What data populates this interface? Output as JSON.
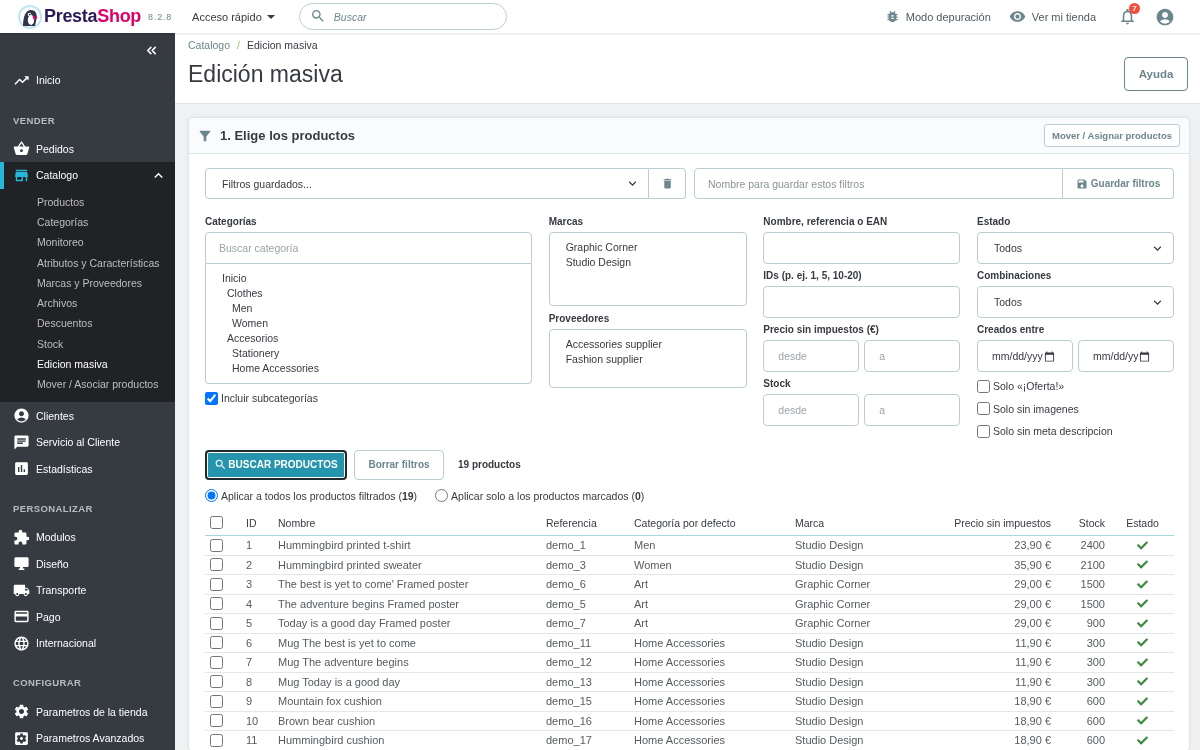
{
  "topbar": {
    "logo": {
      "parts": [
        "Presta",
        "Shop"
      ],
      "version": "8.2.8"
    },
    "quick_access": "Acceso rápido",
    "search": {
      "placeholder": "Buscar"
    },
    "debug_mode": "Modo depuración",
    "view_store": "Ver mi tienda",
    "notifications": {
      "count": "7"
    }
  },
  "sidebar": {
    "sections": [
      {
        "items": [
          {
            "label": "Inicio",
            "selected": false
          }
        ]
      },
      {
        "heading": "VENDER",
        "items": [
          {
            "label": "Pedidos",
            "selected": false
          },
          {
            "label": "Catalogo",
            "selected": true,
            "expanded": true,
            "children": [
              {
                "label": "Productos",
                "selected": false
              },
              {
                "label": "Categorías",
                "selected": false
              },
              {
                "label": "Monitoreo",
                "selected": false
              },
              {
                "label": "Atributos y Características",
                "selected": false
              },
              {
                "label": "Marcas y Proveedores",
                "selected": false
              },
              {
                "label": "Archivos",
                "selected": false
              },
              {
                "label": "Descuentos",
                "selected": false
              },
              {
                "label": "Stock",
                "selected": false
              },
              {
                "label": "Edicion masiva",
                "selected": true
              },
              {
                "label": "Mover / Asociar productos",
                "selected": false
              }
            ]
          },
          {
            "label": "Clientes",
            "selected": false
          },
          {
            "label": "Servicio al Cliente",
            "selected": false
          },
          {
            "label": "Estadísticas",
            "selected": false
          }
        ]
      },
      {
        "heading": "PERSONALIZAR",
        "items": [
          {
            "label": "Modulos",
            "selected": false
          },
          {
            "label": "Diseño",
            "selected": false
          },
          {
            "label": "Transporte",
            "selected": false
          },
          {
            "label": "Pago",
            "selected": false
          },
          {
            "label": "Internacional",
            "selected": false
          }
        ]
      },
      {
        "heading": "CONFIGURAR",
        "items": [
          {
            "label": "Parametros de la tienda",
            "selected": false
          },
          {
            "label": "Parametros Avanzados",
            "selected": false
          }
        ]
      }
    ]
  },
  "header": {
    "breadcrumb": {
      "items": [
        "Catalogo",
        "Edicion masiva"
      ],
      "separator": "/"
    },
    "title": "Edición masiva",
    "help_button": "Ayuda"
  },
  "panel": {
    "title": "1. Elige los productos",
    "action_button": "Mover / Asignar productos",
    "saved_filters": {
      "select": "Filtros guardados...",
      "name_placeholder": "Nombre para guardar estos filtros",
      "save_button": "Guardar filtros"
    },
    "categories": {
      "label": "Categorías",
      "search_placeholder": "Buscar categoría",
      "tree": [
        {
          "label": "Inicio",
          "selected": false,
          "children": [
            {
              "label": "Clothes",
              "selected": false,
              "children": [
                {
                  "label": "Men",
                  "selected": false
                },
                {
                  "label": "Women",
                  "selected": false
                }
              ]
            },
            {
              "label": "Accesorios",
              "selected": false,
              "children": [
                {
                  "label": "Stationery",
                  "selected": false
                },
                {
                  "label": "Home Accessories",
                  "selected": false
                }
              ]
            }
          ]
        }
      ],
      "include_subcategories": {
        "label": "Incluir subcategorías",
        "checked": true
      }
    },
    "brands": {
      "label": "Marcas",
      "options": [
        {
          "label": "Graphic Corner",
          "selected": false
        },
        {
          "label": "Studio Design",
          "selected": false
        }
      ]
    },
    "suppliers": {
      "label": "Proveedores",
      "options": [
        {
          "label": "Accessories supplier",
          "selected": false
        },
        {
          "label": "Fashion supplier",
          "selected": false
        }
      ]
    },
    "name_filter": {
      "label": "Nombre, referencia o EAN"
    },
    "ids_filter": {
      "label": "IDs (p. ej. 1, 5, 10-20)"
    },
    "price_filter": {
      "label": "Precio sin impuestos (€)",
      "from_placeholder": "desde",
      "to_placeholder": "a"
    },
    "stock_filter": {
      "label": "Stock",
      "from_placeholder": "desde",
      "to_placeholder": "a"
    },
    "status_filter": {
      "label": "Estado",
      "value": "Todos"
    },
    "combinations_filter": {
      "label": "Combinaciones",
      "value": "Todos"
    },
    "created_filter": {
      "label": "Creados entre",
      "from_placeholder": "mm/dd/yyy",
      "to_placeholder": "mm/dd/yy"
    },
    "flags": [
      {
        "label": "Solo «¡Oferta!»",
        "checked": false
      },
      {
        "label": "Solo sin imagenes",
        "checked": false
      },
      {
        "label": "Solo sin meta descripcion",
        "checked": false
      }
    ],
    "search_button": "BUSCAR PRODUCTOS",
    "clear_button": "Borrar filtros",
    "result_count": "19 productos",
    "scope": [
      {
        "label": "Aplicar a todos los productos filtrados (**19**)",
        "selected": true
      },
      {
        "label": "Aplicar solo a los productos marcados (**0**)",
        "selected": false
      }
    ],
    "table": {
      "select_all": {
        "checked": false
      },
      "columns": [
        "ID",
        "Nombre",
        "Referencia",
        "Categoría por defecto",
        "Marca",
        "Precio sin impuestos",
        "Stock",
        "Estado"
      ],
      "rows": [
        {
          "checked": false,
          "cells": [
            "1",
            "Hummingbird printed t-shirt",
            "demo_1",
            "Men",
            "Studio Design",
            "23,90 €",
            "2400"
          ],
          "active": true
        },
        {
          "checked": false,
          "cells": [
            "2",
            "Hummingbird printed sweater",
            "demo_3",
            "Women",
            "Studio Design",
            "35,90 €",
            "2100"
          ],
          "active": true
        },
        {
          "checked": false,
          "cells": [
            "3",
            "The best is yet to come' Framed poster",
            "demo_6",
            "Art",
            "Graphic Corner",
            "29,00 €",
            "1500"
          ],
          "active": true
        },
        {
          "checked": false,
          "cells": [
            "4",
            "The adventure begins Framed poster",
            "demo_5",
            "Art",
            "Graphic Corner",
            "29,00 €",
            "1500"
          ],
          "active": true
        },
        {
          "checked": false,
          "cells": [
            "5",
            "Today is a good day Framed poster",
            "demo_7",
            "Art",
            "Graphic Corner",
            "29,00 €",
            "900"
          ],
          "active": true
        },
        {
          "checked": false,
          "cells": [
            "6",
            "Mug The best is yet to come",
            "demo_11",
            "Home Accessories",
            "Studio Design",
            "11,90 €",
            "300"
          ],
          "active": true
        },
        {
          "checked": false,
          "cells": [
            "7",
            "Mug The adventure begins",
            "demo_12",
            "Home Accessories",
            "Studio Design",
            "11,90 €",
            "300"
          ],
          "active": true
        },
        {
          "checked": false,
          "cells": [
            "8",
            "Mug Today is a good day",
            "demo_13",
            "Home Accessories",
            "Studio Design",
            "11,90 €",
            "300"
          ],
          "active": true
        },
        {
          "checked": false,
          "cells": [
            "9",
            "Mountain fox cushion",
            "demo_15",
            "Home Accessories",
            "Studio Design",
            "18,90 €",
            "600"
          ],
          "active": true
        },
        {
          "checked": false,
          "cells": [
            "10",
            "Brown bear cushion",
            "demo_16",
            "Home Accessories",
            "Studio Design",
            "18,90 €",
            "600"
          ],
          "active": true
        },
        {
          "checked": false,
          "cells": [
            "11",
            "Hummingbird cushion",
            "demo_17",
            "Home Accessories",
            "Studio Design",
            "18,90 €",
            "600"
          ],
          "active": true
        }
      ]
    }
  }
}
